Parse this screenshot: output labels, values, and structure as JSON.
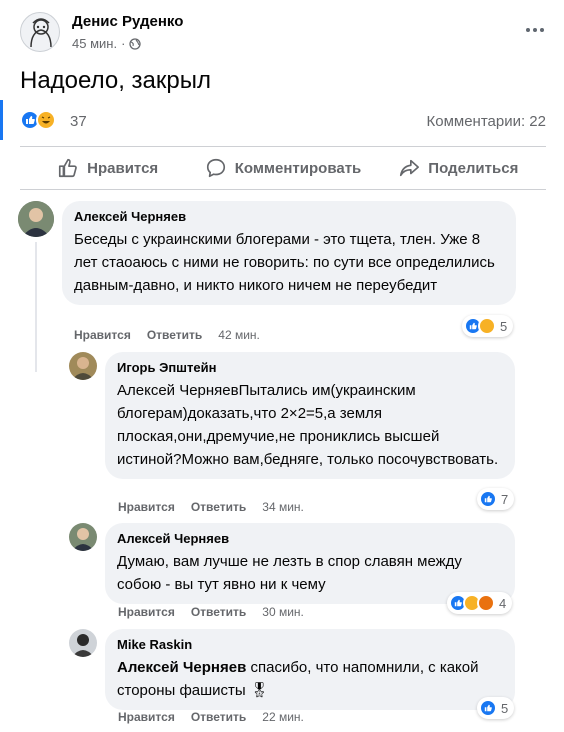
{
  "post": {
    "author": "Денис Руденко",
    "time": "45 мин.",
    "visibility_icon": "globe-icon",
    "text": "Надоело, закрыл",
    "reaction_count": "37",
    "comments_label": "Комментарии: 22"
  },
  "actions": {
    "like": "Нравится",
    "comment": "Комментировать",
    "share": "Поделиться"
  },
  "comments": [
    {
      "name": "Алексей Черняев",
      "text": "Беседы с украинскими блогерами - это тщета, тлен. Уже 8 лет стаоаюсь с ними не говорить: по сути все определились давным-давно, и никто никого ничем не переубедит",
      "like": "Нравится",
      "reply": "Ответить",
      "time": "42 мин.",
      "reactions": "5"
    },
    {
      "name": "Игорь Эпштейн",
      "text": "Алексей ЧерняевПытались им(украинским блогерам)доказать,что 2×2=5,а земля плоская,они,дремучие,не прониклись высшей истиной?Можно вам,бедняге, только посочувствовать.",
      "like": "Нравится",
      "reply": "Ответить",
      "time": "34 мин.",
      "reactions": "7"
    },
    {
      "name": "Алексей Черняев",
      "text": "Думаю, вам лучше не лезть в спор славян между собою - вы тут явно ни к чему",
      "like": "Нравится",
      "reply": "Ответить",
      "time": "30 мин.",
      "reactions": "4"
    },
    {
      "name": "Mike Raskin",
      "mention": "Алексей Черняев",
      "text": " спасибо, что напомнили, с какой стороны фашисты",
      "emoji": "🎖",
      "like": "Нравится",
      "reply": "Ответить",
      "time": "22 мин.",
      "reactions": "5"
    }
  ],
  "colors": {
    "accent": "#1877f2",
    "bubble": "#f0f2f5",
    "secondary_text": "#65676b"
  }
}
